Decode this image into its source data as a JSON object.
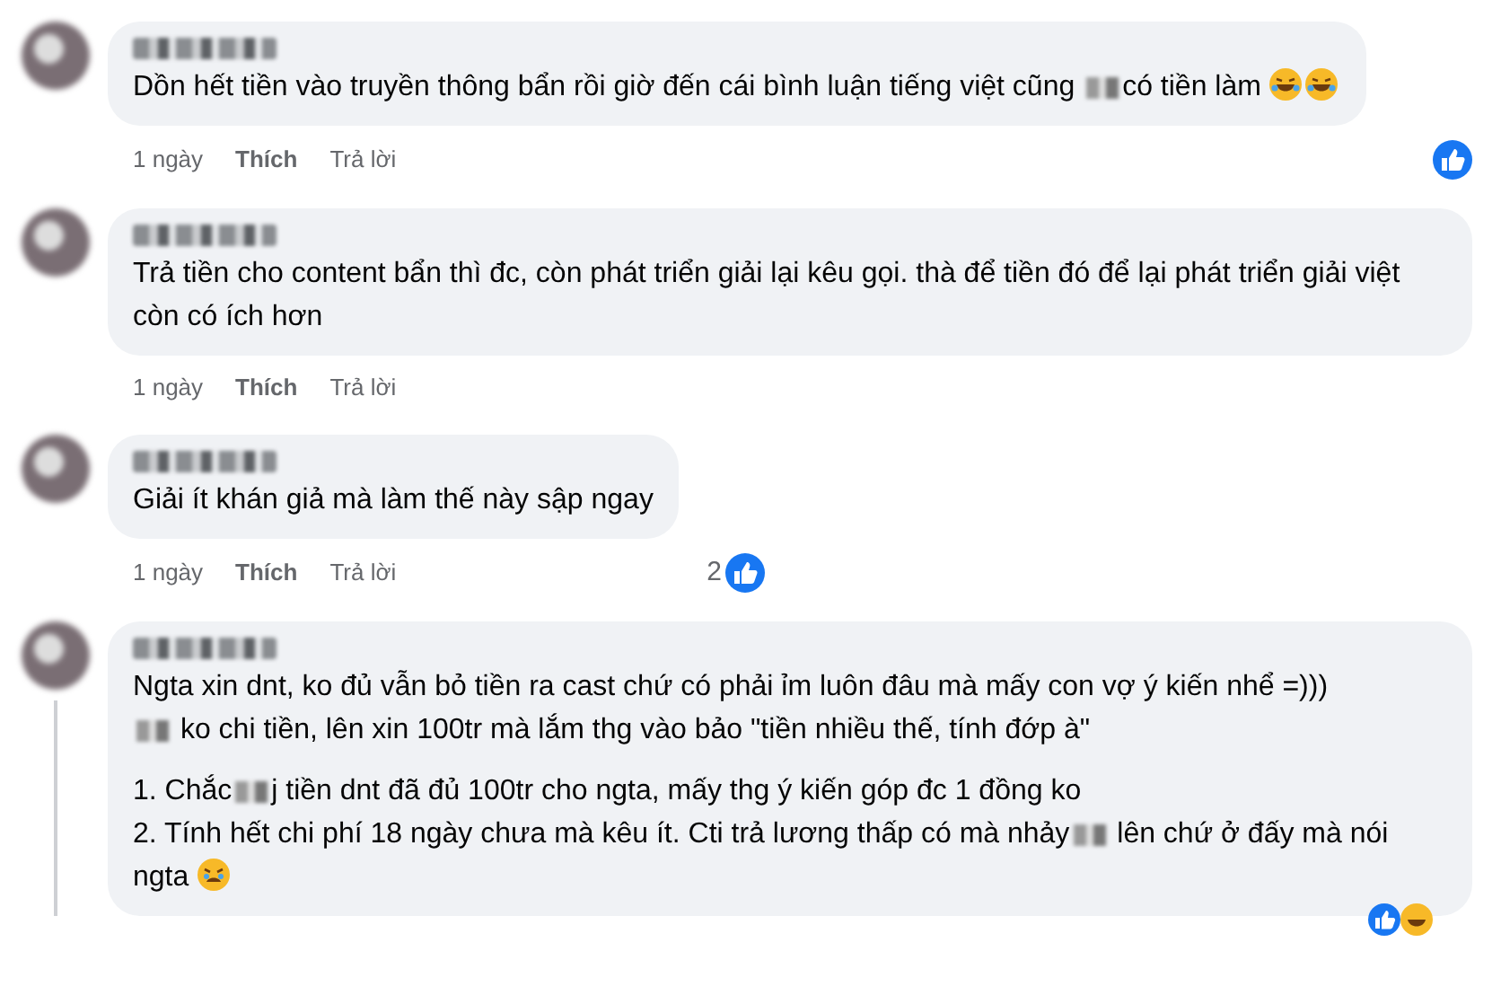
{
  "comments": [
    {
      "blocks": [
        [
          [
            {
              "kind": "text",
              "text": "Dồn hết tiền vào truyền thông bẩn rồi giờ đến cái bình luận tiếng việt cũng "
            },
            {
              "kind": "blur"
            },
            {
              "kind": "text",
              "text": "có tiền làm "
            },
            {
              "kind": "laugh"
            },
            {
              "kind": "laugh"
            }
          ]
        ]
      ],
      "time": "1 ngày",
      "like": "Thích",
      "reply": "Trả lời",
      "like_badge": true,
      "thread": false,
      "bottom_reactions": false
    },
    {
      "blocks": [
        [
          [
            {
              "kind": "text",
              "text": "Trả tiền cho content bẩn thì đc, còn phát triển giải lại kêu gọi. thà để tiền đó để lại phát triển giải việt còn có ích hơn"
            }
          ]
        ]
      ],
      "time": "1 ngày",
      "like": "Thích",
      "reply": "Trả lời",
      "like_badge": false,
      "thread": false,
      "bottom_reactions": false
    },
    {
      "blocks": [
        [
          [
            {
              "kind": "text",
              "text": "Giải ít khán giả mà làm thế này sập ngay"
            }
          ]
        ]
      ],
      "time": "1 ngày",
      "like": "Thích",
      "reply": "Trả lời",
      "like_badge": true,
      "like_count": "2",
      "thread": false,
      "bottom_reactions": false
    },
    {
      "blocks": [
        [
          [
            {
              "kind": "text",
              "text": "Ngta xin dnt, ko đủ vẫn bỏ tiền ra cast chứ có phải ỉm luôn đâu mà mấy con vợ ý kiến nhể =)))"
            }
          ],
          [
            {
              "kind": "blur"
            },
            {
              "kind": "text",
              "text": " ko chi tiền, lên xin 100tr mà lắm thg vào bảo \"tiền nhiều thế, tính đớp à\""
            }
          ]
        ],
        [
          [
            {
              "kind": "text",
              "text": "1. Chắc"
            },
            {
              "kind": "blur"
            },
            {
              "kind": "text",
              "text": "j tiền dnt đã đủ 100tr cho ngta, mấy thg ý kiến góp đc 1 đồng ko"
            }
          ],
          [
            {
              "kind": "text",
              "text": "2. Tính hết chi phí 18 ngày chưa mà kêu ít. Cti trả lương thấp có mà nhảy"
            },
            {
              "kind": "blur"
            },
            {
              "kind": "text",
              "text": " lên chứ ở đấy mà nói ngta "
            },
            {
              "kind": "weary"
            }
          ]
        ]
      ],
      "thread": true,
      "bottom_reactions": true
    }
  ]
}
